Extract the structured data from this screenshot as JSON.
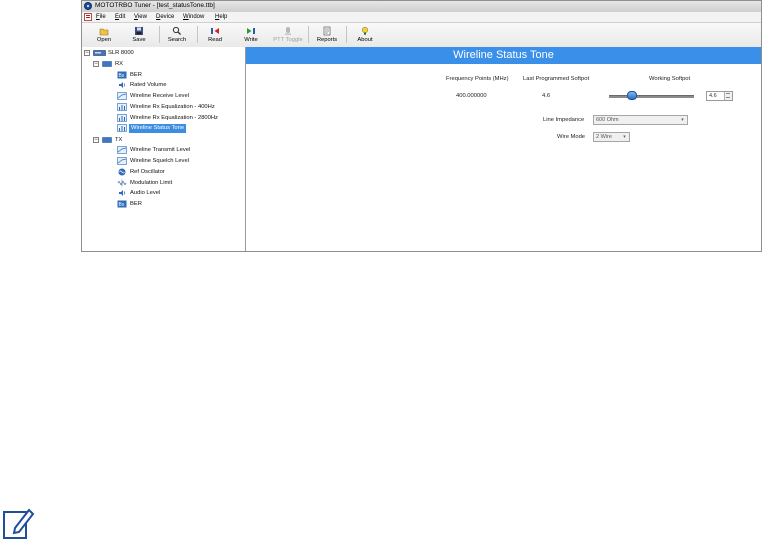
{
  "window": {
    "title": "MOTOTRBO Tuner - [test_statusTone.ttb]"
  },
  "menu": [
    {
      "label": "File"
    },
    {
      "label": "Edit"
    },
    {
      "label": "View"
    },
    {
      "label": "Device"
    },
    {
      "label": "Window"
    },
    {
      "label": "Help"
    }
  ],
  "toolbar": {
    "open": "Open",
    "save": "Save",
    "search": "Search",
    "read": "Read",
    "write": "Write",
    "ptt_toggle": "PTT Toggle",
    "reports": "Reports",
    "about": "About"
  },
  "tree": {
    "root": "SLR 8000",
    "rx": {
      "label": "RX",
      "items": [
        "BER",
        "Rated Volume",
        "Wireline Receive Level",
        "Wireline Rx Equalization - 400Hz",
        "Wireline Rx Equalization - 2800Hz",
        "Wireline Status Tone"
      ]
    },
    "tx": {
      "label": "TX",
      "items": [
        "Wireline Transmit Level",
        "Wireline Squelch Level",
        "Ref Oscillator",
        "Modulation Limit",
        "Audio Level",
        "BER"
      ]
    },
    "selected": "Wireline Status Tone"
  },
  "panel": {
    "title": "Wireline Status Tone",
    "col_freq": "Frequency Points (MHz)",
    "col_last": "Last Programmed Softpot",
    "col_working": "Working Softpot",
    "freq_value": "400.000000",
    "last_value": "4.6",
    "working_value": "4.6",
    "line_impedance_label": "Line Impedance",
    "line_impedance_value": "600 Ohm",
    "wire_mode_label": "Wire Mode",
    "wire_mode_value": "2 Wire"
  },
  "colors": {
    "accent": "#3a8fe8",
    "selection": "#3d8ee0"
  }
}
